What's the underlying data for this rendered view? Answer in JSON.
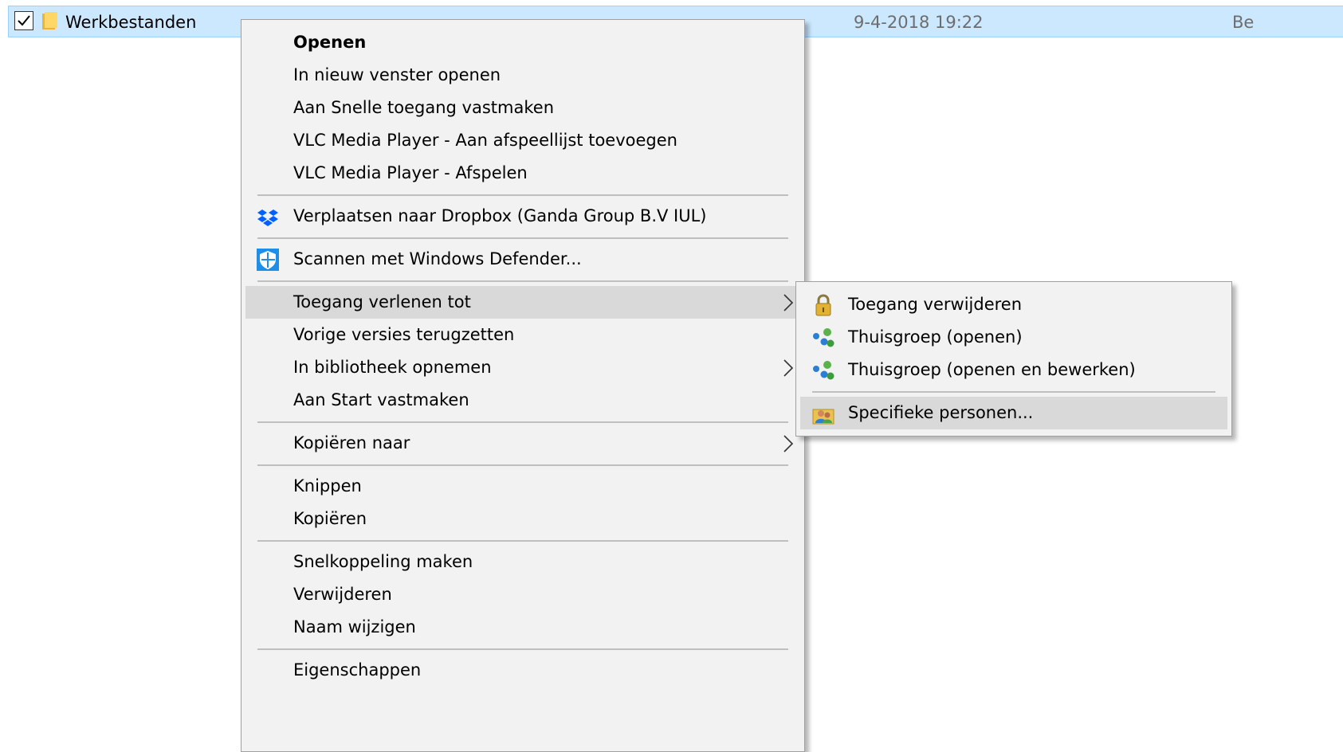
{
  "file_row": {
    "checked": true,
    "name": "Werkbestanden",
    "date": "9-4-2018 19:22",
    "type_partial": "Be"
  },
  "context_menu": {
    "items": [
      {
        "label": "Openen",
        "bold": true
      },
      {
        "label": "In nieuw venster openen"
      },
      {
        "label": "Aan Snelle toegang vastmaken"
      },
      {
        "label": "VLC Media Player - Aan afspeellijst toevoegen"
      },
      {
        "label": "VLC Media Player - Afspelen"
      },
      {
        "label": "Verplaatsen naar Dropbox (Ganda Group B.V IUL)",
        "icon": "dropbox-icon"
      },
      {
        "label": "Scannen met Windows Defender...",
        "icon": "windows-defender-icon"
      },
      {
        "label": "Toegang verlenen tot",
        "has_submenu": true,
        "highlighted": true
      },
      {
        "label": "Vorige versies terugzetten"
      },
      {
        "label": "In bibliotheek opnemen",
        "has_submenu": true
      },
      {
        "label": "Aan Start vastmaken"
      },
      {
        "label": "Kopiëren naar",
        "has_submenu": true
      },
      {
        "label": "Knippen"
      },
      {
        "label": "Kopiëren"
      },
      {
        "label": "Snelkoppeling maken"
      },
      {
        "label": "Verwijderen"
      },
      {
        "label": "Naam wijzigen"
      },
      {
        "label": "Eigenschappen"
      }
    ]
  },
  "submenu": {
    "items": [
      {
        "label": "Toegang verwijderen",
        "icon": "lock-icon"
      },
      {
        "label": "Thuisgroep (openen)",
        "icon": "homegroup-icon"
      },
      {
        "label": "Thuisgroep (openen en bewerken)",
        "icon": "homegroup-icon"
      },
      {
        "label": "Specifieke personen...",
        "icon": "specific-people-icon",
        "highlighted": true
      }
    ]
  },
  "colors": {
    "selection_bg": "#cce8ff",
    "menu_bg": "#f2f2f2",
    "menu_hover": "#d9d9d9",
    "separator": "#bfbfbf"
  }
}
